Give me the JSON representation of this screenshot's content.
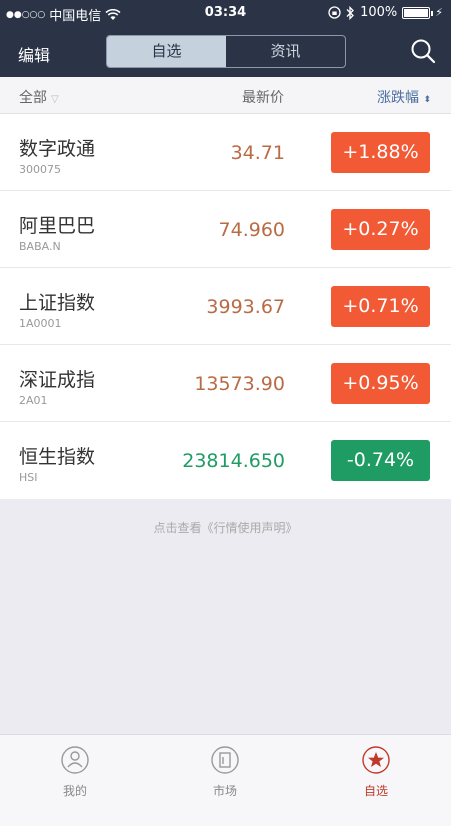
{
  "status_bar": {
    "carrier": "中国电信",
    "time": "03:34",
    "battery": "100%"
  },
  "nav": {
    "edit_label": "编辑",
    "tabs": [
      "自选",
      "资讯"
    ]
  },
  "list_header": {
    "all_label": "全部",
    "price_label": "最新价",
    "change_label": "涨跌幅"
  },
  "stocks": [
    {
      "name": "数字政通",
      "code": "300075",
      "price": "34.71",
      "change": "+1.88%"
    },
    {
      "name": "阿里巴巴",
      "code": "BABA.N",
      "price": "74.960",
      "change": "+0.27%"
    },
    {
      "name": "上证指数",
      "code": "1A0001",
      "price": "3993.67",
      "change": "+0.71%"
    },
    {
      "name": "深证成指",
      "code": "2A01",
      "price": "13573.90",
      "change": "+0.95%"
    },
    {
      "name": "恒生指数",
      "code": "HSI",
      "price": "23814.650",
      "change": "-0.74%"
    }
  ],
  "disclaimer": "点击查看《行情使用声明》",
  "tab_bar": {
    "items": [
      "我的",
      "市场",
      "自选"
    ]
  },
  "colors": {
    "up": "#f15a35",
    "down": "#1f9c64",
    "nav_bg": "#2b3447"
  },
  "icons": {
    "search": "search-icon",
    "wifi": "wifi-icon",
    "bluetooth": "bluetooth-icon",
    "battery": "battery-icon",
    "tab_me": "user-icon",
    "tab_market": "market-icon",
    "tab_watchlist": "star-icon"
  }
}
